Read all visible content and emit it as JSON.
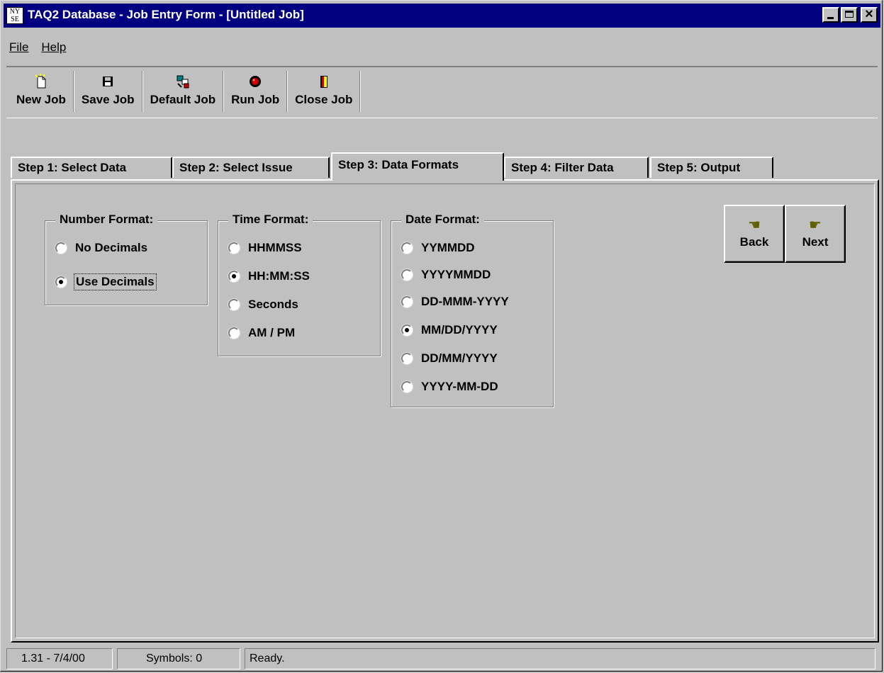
{
  "window": {
    "title": "TAQ2 Database - Job Entry Form - [Untitled Job]",
    "app_icon_lines": [
      "NY",
      "SE"
    ]
  },
  "menu": {
    "items": [
      "File",
      "Help"
    ]
  },
  "toolbar": {
    "buttons": [
      {
        "label": "New Job",
        "icon": "new-document-icon"
      },
      {
        "label": "Save Job",
        "icon": "floppy-disk-icon"
      },
      {
        "label": "Default Job",
        "icon": "default-job-icon"
      },
      {
        "label": "Run Job",
        "icon": "record-button-icon"
      },
      {
        "label": "Close Job",
        "icon": "exit-door-icon"
      }
    ]
  },
  "tabs": [
    {
      "label": "Step 1: Select Data",
      "active": false
    },
    {
      "label": "Step 2: Select Issue",
      "active": false
    },
    {
      "label": "Step 3: Data Formats",
      "active": true
    },
    {
      "label": "Step 4: Filter Data",
      "active": false
    },
    {
      "label": "Step 5: Output",
      "active": false
    }
  ],
  "number_format": {
    "title": "Number Format:",
    "options": [
      "No Decimals",
      "Use Decimals"
    ],
    "selected": "Use Decimals"
  },
  "time_format": {
    "title": "Time Format:",
    "options": [
      "HHMMSS",
      "HH:MM:SS",
      "Seconds",
      "AM / PM"
    ],
    "selected": "HH:MM:SS"
  },
  "date_format": {
    "title": "Date Format:",
    "options": [
      "YYMMDD",
      "YYYYMMDD",
      "DD-MMM-YYYY",
      "MM/DD/YYYY",
      "DD/MM/YYYY",
      "YYYY-MM-DD"
    ],
    "selected": "MM/DD/YYYY"
  },
  "nav": {
    "back_label": "Back",
    "next_label": "Next",
    "back_icon": "pointing-hand-left-icon",
    "next_icon": "pointing-hand-right-icon"
  },
  "status": {
    "version": "1.31 - 7/4/00",
    "symbols": "Symbols: 0",
    "message": "Ready."
  }
}
